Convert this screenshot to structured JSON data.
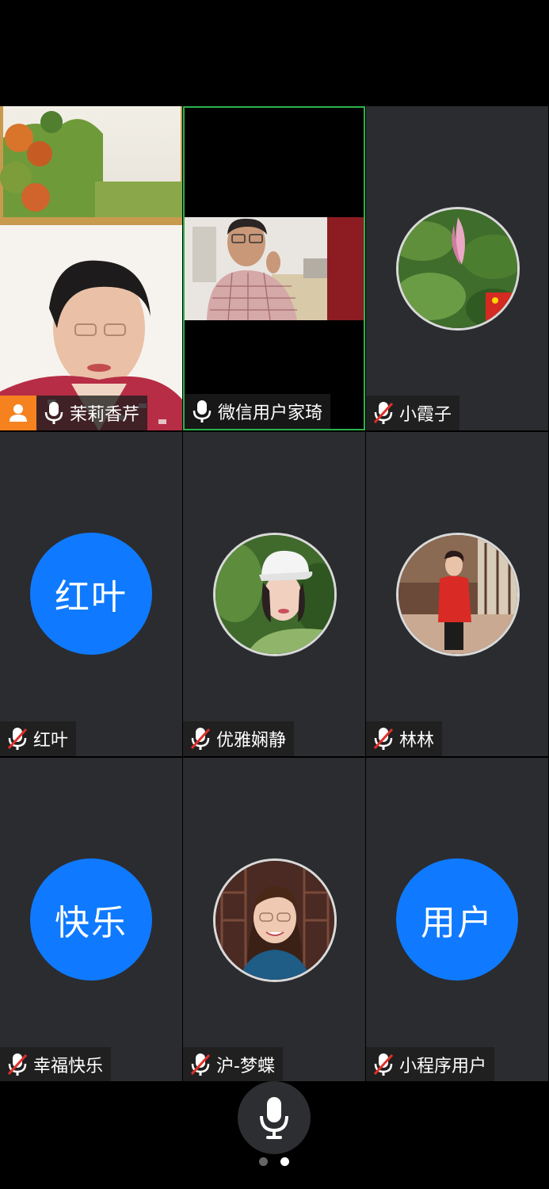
{
  "participants": [
    {
      "name": "茉莉香芹",
      "mic": "on",
      "type": "video",
      "host": true
    },
    {
      "name": "微信用户家琦",
      "mic": "on",
      "type": "video",
      "active_speaker": true
    },
    {
      "name": "小霞子",
      "mic": "muted",
      "type": "photo"
    },
    {
      "name": "红叶",
      "mic": "muted",
      "type": "initials",
      "avatar_text": "红叶"
    },
    {
      "name": "优雅娴静",
      "mic": "muted",
      "type": "photo"
    },
    {
      "name": "林林",
      "mic": "muted",
      "type": "photo"
    },
    {
      "name": "幸福快乐",
      "mic": "muted",
      "type": "initials",
      "avatar_text": "快乐"
    },
    {
      "name": "沪-梦蝶",
      "mic": "muted",
      "type": "photo"
    },
    {
      "name": "小程序用户",
      "mic": "muted",
      "type": "initials",
      "avatar_text": "用户"
    }
  ],
  "controls": {
    "mic_button_icon": "microphone-icon",
    "page_indicator": {
      "pages": 2,
      "current": 2
    }
  },
  "colors": {
    "tile_bg": "#2b2c2f",
    "avatar_blue": "#0f7aff",
    "active_border": "#2bb24c",
    "host_badge": "#f5821f",
    "muted_red": "#e0302a"
  }
}
